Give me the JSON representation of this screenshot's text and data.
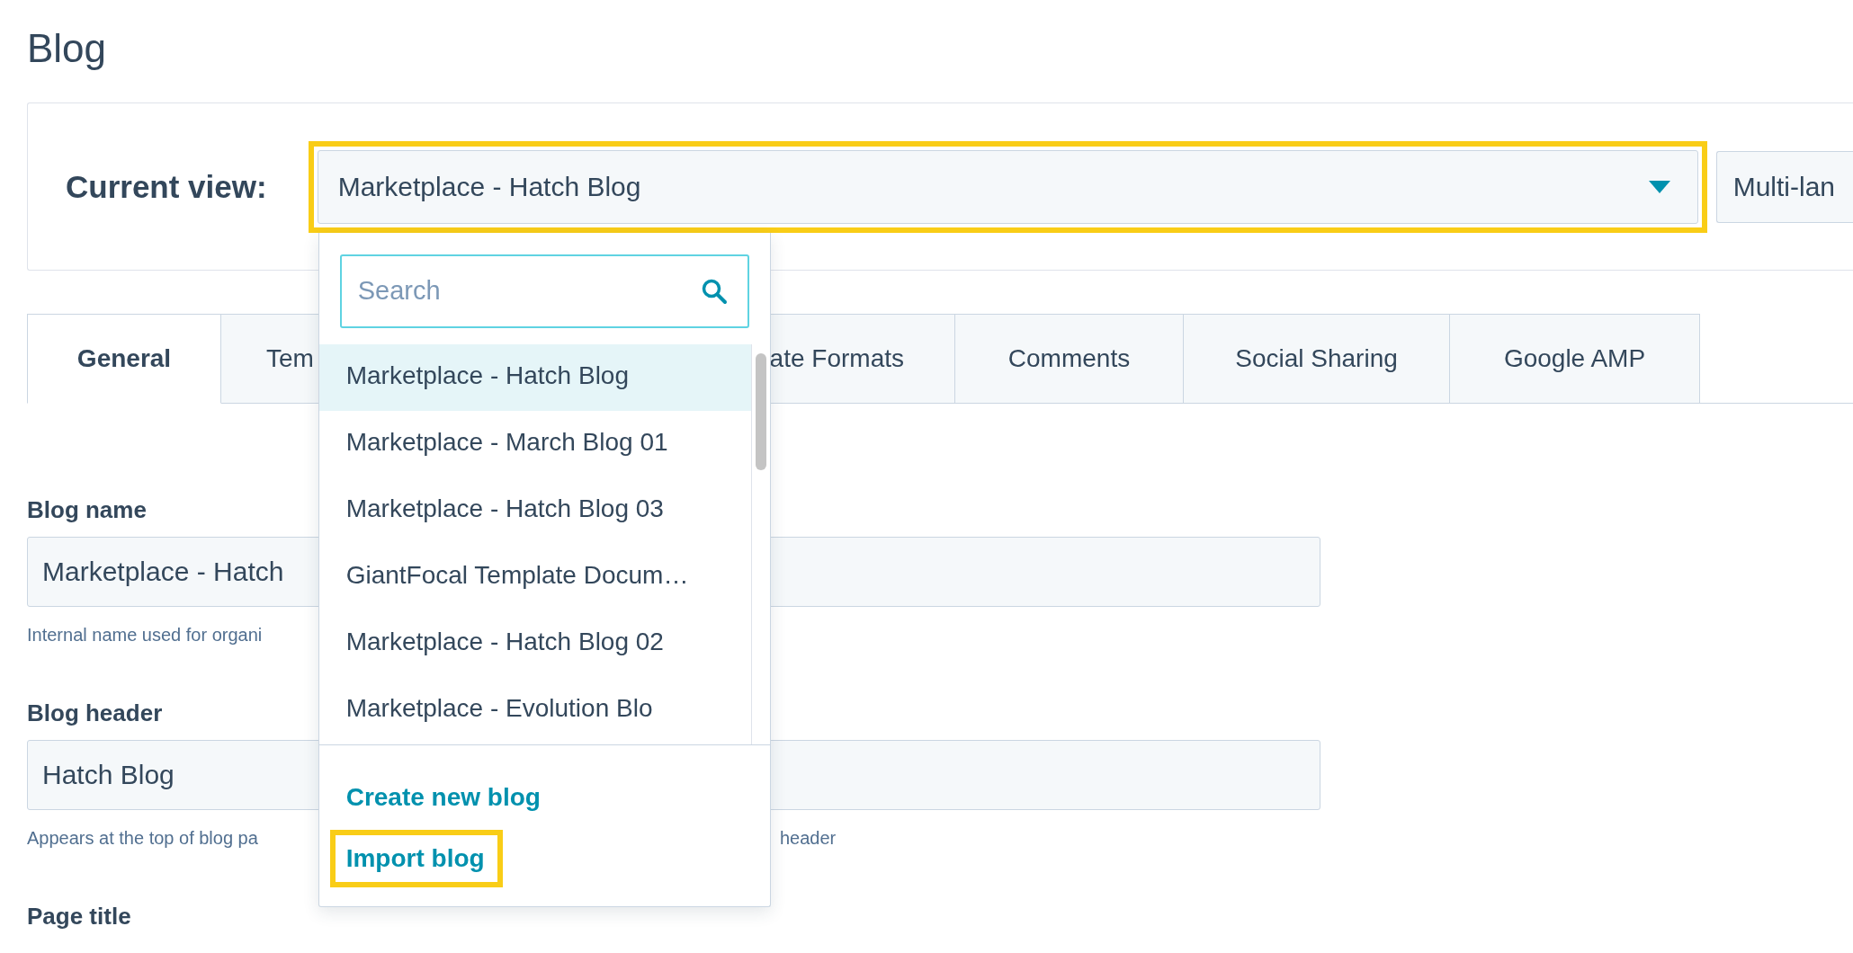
{
  "page_title": "Blog",
  "current_view": {
    "label": "Current view:",
    "value": "Marketplace - Hatch Blog",
    "highlighted": true,
    "side_button": "Multi-lan"
  },
  "dropdown": {
    "search": {
      "placeholder": "Search"
    },
    "items": [
      {
        "label": "Marketplace - Hatch Blog",
        "selected": true
      },
      {
        "label": "Marketplace - March Blog 01",
        "selected": false
      },
      {
        "label": "Marketplace - Hatch Blog 03",
        "selected": false
      },
      {
        "label": "GiantFocal Template Docum…",
        "selected": false
      },
      {
        "label": "Marketplace - Hatch Blog 02",
        "selected": false
      },
      {
        "label": "Marketplace - Evolution Blo",
        "selected": false
      }
    ],
    "actions": [
      {
        "label": "Create new blog",
        "highlighted": false
      },
      {
        "label": "Import blog",
        "highlighted": true
      }
    ]
  },
  "tabs": [
    {
      "label": "General",
      "selected": true
    },
    {
      "label": "Tem",
      "selected": false
    },
    {
      "label": "ate Formats",
      "selected": false
    },
    {
      "label": "Comments",
      "selected": false
    },
    {
      "label": "Social Sharing",
      "selected": false
    },
    {
      "label": "Google AMP",
      "selected": false
    }
  ],
  "fields": [
    {
      "label": "Blog name",
      "value": [
        "Marketplace - Hatch"
      ],
      "help": [
        "Internal name used for organi"
      ]
    },
    {
      "label": "Blog header",
      "value": [
        "Hatch Blog"
      ],
      "help": [
        "Appears at the top of blog pa",
        "header"
      ]
    },
    {
      "label": "Page title"
    }
  ]
}
